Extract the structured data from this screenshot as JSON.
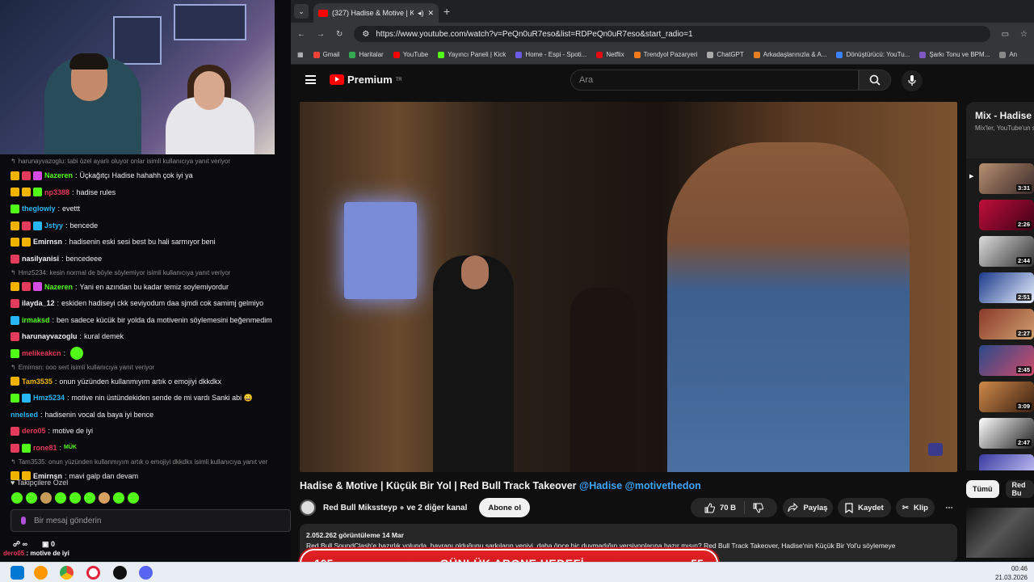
{
  "browser": {
    "tab_title": "(327) Hadise & Motive | Küç",
    "url": "https://www.youtube.com/watch?v=PeQn0uR7eso&list=RDPeQn0uR7eso&start_radio=1",
    "bookmarks": [
      "Gmail",
      "Haritalar",
      "YouTube",
      "Yayıncı Paneli | Kick",
      "Home - Espi - Spoti...",
      "Netflix",
      "Trendyol Pazaryeri",
      "ChatGPT",
      "Arkadaşlarınızla & A...",
      "Dönüştürücü: YouTu...",
      "Şarkı Tonu ve BPM...",
      "An"
    ]
  },
  "youtube": {
    "logo": "Premium",
    "logo_sup": "TR",
    "search_placeholder": "Ara",
    "video_title": "Hadise & Motive | Küçük Bir Yol | Red Bull Track Takeover",
    "title_tags": "@Hadise @motivethedon",
    "channel": "Red Bull Mikssteyp",
    "channel_suffix": "ve 2 diğer kanal",
    "subscribe": "Abone ol",
    "likes": "70 B",
    "share": "Paylaş",
    "save": "Kaydet",
    "clip": "Klip",
    "views_date": "2.052.262 görüntüleme  14 Mar",
    "description": "Red Bull SoundClash'e hazırlık yolunda, hayranı olduğunu şarkıların yeniyi, daha önce hiç duymadığın versiyonlarına hazır mısın? Red Bull Track Takeover, Hadise'nin Küçük Bir Yol'u söylemeye",
    "mix_title": "Mix - Hadise",
    "mix_subtitle": "Mix'ler, YouTube'un s",
    "mix_durations": [
      "3:31",
      "2:26",
      "2:44",
      "2:51",
      "2:27",
      "2:45",
      "3:09",
      "2:47",
      ""
    ],
    "chips": [
      "Tümü",
      "Red Bu"
    ]
  },
  "overlay": {
    "goal_left": "105",
    "goal_title": "GÜNLÜK ABONE HEDEFİ",
    "goal_right": "55"
  },
  "chat": {
    "lines": [
      {
        "type": "reply",
        "text": "harunayvazoglu: tabi özel ayarlı oluyor onlar isimli kullanıcıya yanıt veriyor"
      },
      {
        "type": "msg",
        "badges": [
          "crown",
          "mod",
          "gift"
        ],
        "user": "Nazeren",
        "color": "#53fc18",
        "text": "Üçkağıtçı Hadise hahahh çok iyi ya"
      },
      {
        "type": "msg",
        "badges": [
          "crown",
          "crown",
          "sub"
        ],
        "user": "np3388",
        "color": "#e33b5c",
        "text": "hadise rules"
      },
      {
        "type": "msg",
        "badges": [
          "sub"
        ],
        "user": "theglowiy",
        "color": "#29b6f6",
        "text": "evettt"
      },
      {
        "type": "msg",
        "badges": [
          "crown",
          "mod",
          "vip"
        ],
        "user": "Jstyy",
        "color": "#29b6f6",
        "text": "bencede"
      },
      {
        "type": "msg",
        "badges": [
          "crown",
          "crown"
        ],
        "user": "Emirnsn",
        "color": "#f1f1f1",
        "text": "hadisenin eski sesi best bu hali sarmıyor beni"
      },
      {
        "type": "msg",
        "badges": [
          "mod"
        ],
        "user": "nasilyanisi",
        "color": "#f1f1f1",
        "text": "bencedeee"
      },
      {
        "type": "reply",
        "text": "Hmz5234: kesin normal de böyle söylemiyor isimli kullanıcıya yanıt veriyor"
      },
      {
        "type": "msg",
        "badges": [
          "crown",
          "mod",
          "gift"
        ],
        "user": "Nazeren",
        "color": "#53fc18",
        "text": "Yani en azından bu kadar temiz soylemiyordur"
      },
      {
        "type": "msg",
        "badges": [
          "mod"
        ],
        "user": "ilayda_12",
        "color": "#f1f1f1",
        "text": "eskiden hadiseyi ckk seviyodum daa sjmdi cok samimj gelmiyo"
      },
      {
        "type": "msg",
        "badges": [
          "vip"
        ],
        "user": "irmaksd",
        "color": "#53fc18",
        "text": "ben sadece kücük bir yolda da motivenin söylemesini beğenmedim"
      },
      {
        "type": "msg",
        "badges": [
          "mod"
        ],
        "user": "harunayvazoglu",
        "color": "#f1f1f1",
        "text": "kural demek"
      },
      {
        "type": "msg",
        "badges": [
          "sub"
        ],
        "user": "melikeakcn",
        "color": "#e33b5c",
        "text": ""
      },
      {
        "type": "reply",
        "text": "Emirnsn: ooo sert isimli kullanıcıya yanıt veriyor"
      },
      {
        "type": "msg",
        "badges": [
          "crown"
        ],
        "user": "Tam3535",
        "color": "#f0b400",
        "text": "onun yüzünden kullanmıyım artık o emojiyi dkkdkx"
      },
      {
        "type": "msg",
        "badges": [
          "sub",
          "vip"
        ],
        "user": "Hmz5234",
        "color": "#29b6f6",
        "text": "motive nin üstündekiden sende de mi vardı Sanki abi 😄"
      },
      {
        "type": "msg",
        "badges": [],
        "user": "nnelsed",
        "color": "#29b6f6",
        "text": "hadisenin vocal da baya iyi bence"
      },
      {
        "type": "msg",
        "badges": [
          "mod"
        ],
        "user": "dero05",
        "color": "#e33b5c",
        "text": "motive de iyi"
      },
      {
        "type": "msg",
        "badges": [
          "mod",
          "sub"
        ],
        "user": "rone81",
        "color": "#e33b5c",
        "text": "MÜK"
      },
      {
        "type": "reply",
        "text": "Tam3535: onun yüzünden kullanmıyım artık o emojiyi dkkdkx isimli kullanıcıya yanıt ver"
      },
      {
        "type": "msg",
        "badges": [
          "crown",
          "crown"
        ],
        "user": "Emirnsn",
        "color": "#f1f1f1",
        "text": "mavi galp dan devam"
      }
    ],
    "emotes_label": "Takipçilere Özel",
    "input_placeholder": "Bir mesaj gönderin",
    "stat1": "0",
    "last": "motive de iyi"
  },
  "taskbar": {
    "time": "00:46",
    "date": "21.03.2026"
  }
}
